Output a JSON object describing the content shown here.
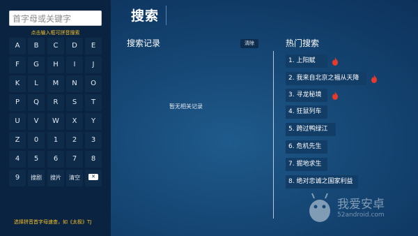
{
  "search": {
    "placeholder": "首字母或关键字",
    "hint": "点击输入框可拼音搜索"
  },
  "keyboard": {
    "rows": [
      [
        "A",
        "B",
        "C",
        "D",
        "E"
      ],
      [
        "F",
        "G",
        "H",
        "I",
        "J"
      ],
      [
        "K",
        "L",
        "M",
        "N",
        "O"
      ],
      [
        "P",
        "Q",
        "R",
        "S",
        "T"
      ],
      [
        "U",
        "V",
        "W",
        "X",
        "Y"
      ],
      [
        "Z",
        "0",
        "1",
        "2",
        "3"
      ],
      [
        "4",
        "5",
        "6",
        "7",
        "8"
      ],
      [
        "9",
        "搜剧",
        "搜片",
        "清空",
        "⌫"
      ]
    ],
    "backspace_icon": "backspace-icon"
  },
  "footer_hint": "选择拼音首字母速查，如《太极》TJ",
  "page_title": "搜索",
  "history": {
    "heading": "搜索记录",
    "clear_label": "清除",
    "empty_message": "暂无相关记录"
  },
  "hot": {
    "heading": "热门搜索",
    "items": [
      {
        "label": "1. 上阳赋",
        "hot": true
      },
      {
        "label": "2. 我来自北京之福从天降",
        "hot": true
      },
      {
        "label": "3. 寻龙秘境",
        "hot": true
      },
      {
        "label": "4. 狂鼠列车",
        "hot": false
      },
      {
        "label": "5. 跨过鸭绿江",
        "hot": false
      },
      {
        "label": "6. 危机先生",
        "hot": false
      },
      {
        "label": "7. 掘地求生",
        "hot": false
      },
      {
        "label": "8. 绝对忠诚之国家利益",
        "hot": false
      }
    ],
    "hot_icon": "fire-icon",
    "hot_color": "#e8392b"
  },
  "watermark": {
    "text": "我爱安卓",
    "sub": "52android.com"
  },
  "colors": {
    "accent_yellow": "#f5c12b",
    "background": "#174a78",
    "panel": "#0a2340"
  }
}
